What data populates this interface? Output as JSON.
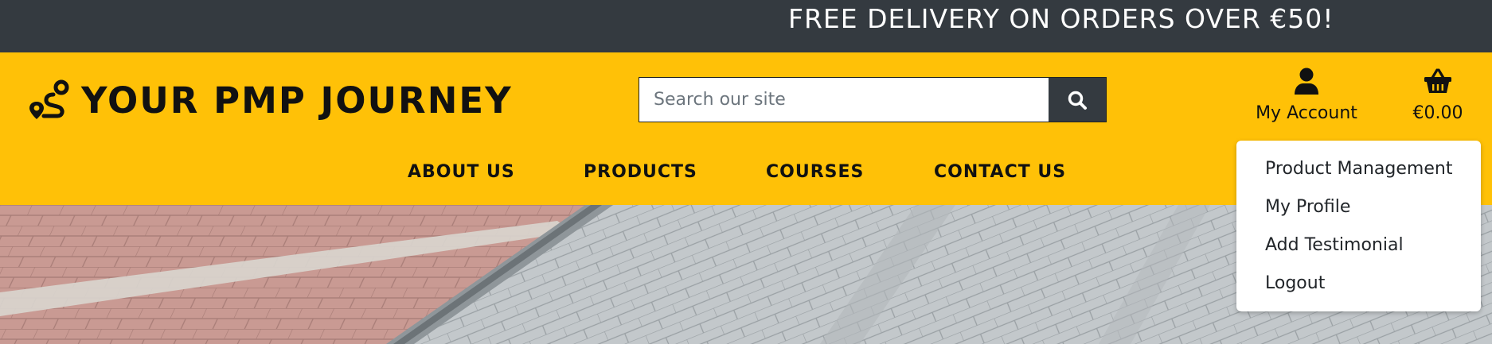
{
  "promo": {
    "text": "FREE DELIVERY ON ORDERS OVER €50!"
  },
  "header": {
    "brand": {
      "title": "YOUR PMP JOURNEY",
      "icon": "route-icon"
    },
    "search": {
      "placeholder": "Search our site",
      "value": "",
      "icon": "search-icon"
    },
    "account": {
      "label": "My Account",
      "icon": "user-icon"
    },
    "basket": {
      "label": "€0.00",
      "icon": "basket-icon"
    }
  },
  "nav": {
    "items": [
      {
        "label": "ABOUT US"
      },
      {
        "label": "PRODUCTS"
      },
      {
        "label": "COURSES"
      },
      {
        "label": "CONTACT US"
      }
    ]
  },
  "account_menu": {
    "items": [
      {
        "label": "Product Management"
      },
      {
        "label": "My Profile"
      },
      {
        "label": "Add Testimonial"
      },
      {
        "label": "Logout"
      }
    ]
  },
  "colors": {
    "promo_bg": "#343a40",
    "header_bg": "#ffc107",
    "search_button_bg": "#343a40",
    "text_dark": "#111111"
  }
}
